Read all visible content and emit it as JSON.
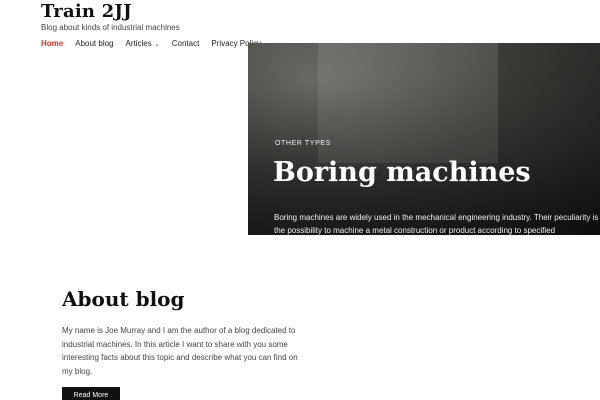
{
  "header": {
    "site_title": "Train 2JJ",
    "tagline": "Blog about kinds of industrial machines"
  },
  "nav": {
    "items": [
      {
        "label": "Home",
        "active": true
      },
      {
        "label": "About blog",
        "active": false
      },
      {
        "label": "Articles",
        "active": false,
        "has_dropdown": true
      },
      {
        "label": "Contact",
        "active": false
      },
      {
        "label": "Privacy Policy",
        "active": false
      }
    ]
  },
  "hero": {
    "category": "OTHER TYPES",
    "title": "Boring machines",
    "excerpt": "Boring machines are widely used in the mechanical engineering industry. Their peculiarity is the possibility to machine a metal construction or product according to specified"
  },
  "about": {
    "title": "About blog",
    "text": "My name is Joe Murray and I am the author of a blog dedicated to industrial machines. In this article I want to share with you some interesting facts about this topic and describe what you can find on my blog.",
    "button_label": "Read More"
  },
  "colors": {
    "accent": "#d23a2f",
    "button_bg": "#111111"
  }
}
